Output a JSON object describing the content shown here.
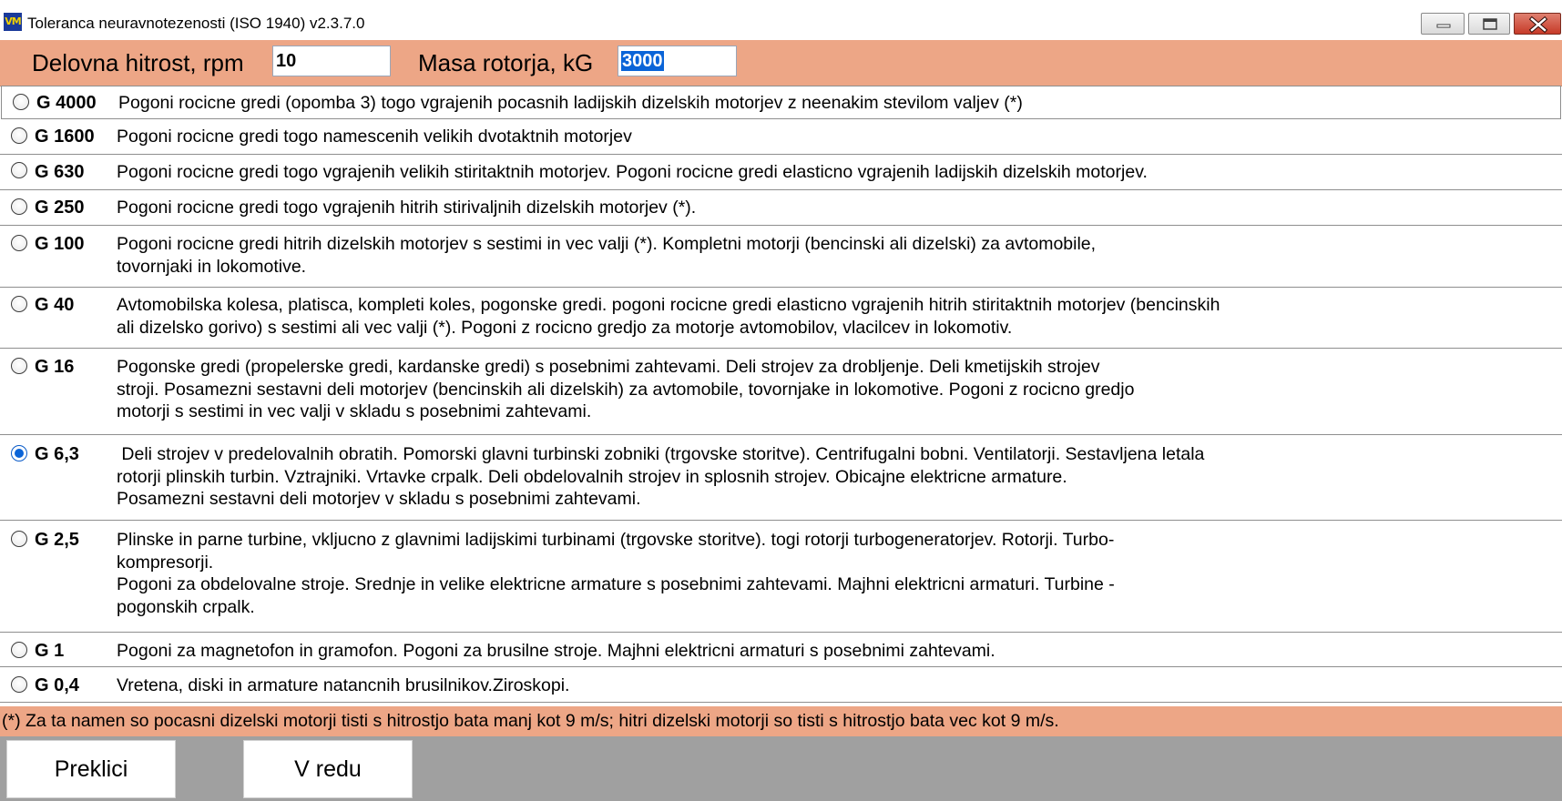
{
  "window": {
    "title": "Toleranca neuravnotezenosti (ISO 1940) v2.3.7.0",
    "app_icon_text": "VM",
    "controls": [
      "minimize-icon",
      "maximize-icon",
      "close-icon"
    ]
  },
  "header": {
    "speed_label": "Delovna hitrost, rpm",
    "speed_value": "10",
    "mass_label": "Masa rotorja, kG",
    "mass_value": "3000"
  },
  "grades": [
    {
      "grade": "G 4000",
      "checked": false,
      "lines": [
        "Pogoni rocicne gredi (opomba 3) togo vgrajenih pocasnih ladijskih dizelskih motorjev z neenakim stevilom valjev (*)"
      ]
    },
    {
      "grade": "G 1600",
      "checked": false,
      "lines": [
        "Pogoni rocicne gredi togo namescenih velikih dvotaktnih motorjev"
      ]
    },
    {
      "grade": "G 630",
      "checked": false,
      "lines": [
        "Pogoni rocicne gredi togo vgrajenih velikih stiritaktnih motorjev. Pogoni rocicne gredi elasticno vgrajenih ladijskih dizelskih motorjev."
      ]
    },
    {
      "grade": "G 250",
      "checked": false,
      "lines": [
        "Pogoni rocicne gredi togo vgrajenih hitrih stirivaljnih dizelskih motorjev (*)."
      ]
    },
    {
      "grade": "G 100",
      "checked": false,
      "lines": [
        "Pogoni rocicne gredi hitrih dizelskih motorjev s sestimi in vec valji (*). Kompletni motorji (bencinski ali dizelski) za avtomobile,",
        "tovornjaki in lokomotive."
      ]
    },
    {
      "grade": "G 40",
      "checked": false,
      "lines": [
        "Avtomobilska kolesa, platisca, kompleti koles, pogonske gredi. pogoni rocicne gredi elasticno vgrajenih hitrih stiritaktnih motorjev (bencinskih",
        "ali dizelsko gorivo) s sestimi ali vec valji (*). Pogoni z rocicno gredjo za motorje avtomobilov, vlacilcev in lokomotiv."
      ]
    },
    {
      "grade": "G 16",
      "checked": false,
      "lines": [
        "Pogonske gredi (propelerske gredi, kardanske gredi) s posebnimi zahtevami. Deli strojev za drobljenje. Deli kmetijskih strojev",
        "stroji. Posamezni sestavni deli motorjev (bencinskih ali dizelskih) za avtomobile, tovornjake in lokomotive. Pogoni z rocicno gredjo",
        "motorji s sestimi in vec valji v skladu s posebnimi zahtevami."
      ]
    },
    {
      "grade": "G 6,3",
      "checked": true,
      "lines": [
        " Deli strojev v predelovalnih obratih. Pomorski glavni turbinski zobniki (trgovske storitve). Centrifugalni bobni. Ventilatorji. Sestavljena letala",
        "rotorji plinskih turbin. Vztrajniki. Vrtavke crpalk. Deli obdelovalnih strojev in splosnih strojev. Obicajne elektricne armature.",
        "Posamezni sestavni deli motorjev v skladu s posebnimi zahtevami."
      ]
    },
    {
      "grade": "G 2,5",
      "checked": false,
      "lines": [
        "Plinske in parne turbine, vkljucno z glavnimi ladijskimi turbinami (trgovske storitve). togi rotorji turbogeneratorjev. Rotorji. Turbo-",
        "kompresorji.",
        "Pogoni za obdelovalne stroje. Srednje in velike elektricne armature s posebnimi zahtevami. Majhni elektricni armaturi. Turbine -",
        "pogonskih crpalk."
      ]
    },
    {
      "grade": "G 1",
      "checked": false,
      "lines": [
        "Pogoni za magnetofon in gramofon. Pogoni za brusilne stroje. Majhni elektricni armaturi s posebnimi zahtevami."
      ]
    },
    {
      "grade": "G 0,4",
      "checked": false,
      "lines": [
        "Vretena, diski in armature natancnih brusilnikov.Ziroskopi."
      ]
    }
  ],
  "footnote": "(*) Za ta namen so pocasni dizelski motorji tisti s hitrostjo bata manj kot 9 m/s; hitri dizelski motorji so tisti s hitrostjo bata vec kot 9 m/s.",
  "buttons": {
    "cancel": "Preklici",
    "ok": "V redu"
  },
  "colors": {
    "band": "#eda686",
    "bottom_bar": "#a0a0a0",
    "selection": "#0a64d8"
  }
}
